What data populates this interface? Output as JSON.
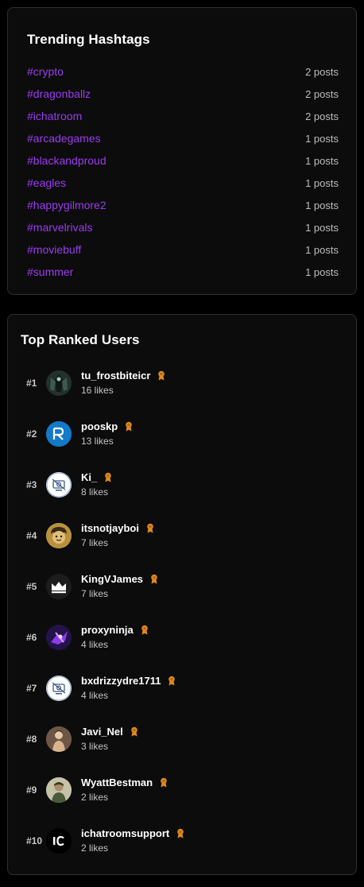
{
  "trending": {
    "title": "Trending Hashtags",
    "tags": [
      {
        "tag": "#crypto",
        "count": "2 posts"
      },
      {
        "tag": "#dragonballz",
        "count": "2 posts"
      },
      {
        "tag": "#ichatroom",
        "count": "2 posts"
      },
      {
        "tag": "#arcadegames",
        "count": "1 posts"
      },
      {
        "tag": "#blackandproud",
        "count": "1 posts"
      },
      {
        "tag": "#eagles",
        "count": "1 posts"
      },
      {
        "tag": "#happygilmore2",
        "count": "1 posts"
      },
      {
        "tag": "#marvelrivals",
        "count": "1 posts"
      },
      {
        "tag": "#moviebuff",
        "count": "1 posts"
      },
      {
        "tag": "#summer",
        "count": "1 posts"
      }
    ]
  },
  "ranked": {
    "title": "Top Ranked Users",
    "badge_icon": "award-ribbon-icon",
    "badge_color": "#e08a1e",
    "users": [
      {
        "rank": "#1",
        "name": "tu_frostbiteicr",
        "likes": "16 likes",
        "avatar": "warrior-avatar"
      },
      {
        "rank": "#2",
        "name": "pooskp",
        "likes": "13 likes",
        "avatar": "letter-r-logo-avatar"
      },
      {
        "rank": "#3",
        "name": "Ki_",
        "likes": "8 likes",
        "avatar": "no-photo-avatar"
      },
      {
        "rank": "#4",
        "name": "itsnotjayboi",
        "likes": "7 likes",
        "avatar": "cartoon-face-avatar"
      },
      {
        "rank": "#5",
        "name": "KingVJames",
        "likes": "7 likes",
        "avatar": "crown-avatar"
      },
      {
        "rank": "#6",
        "name": "proxyninja",
        "likes": "4 likes",
        "avatar": "purple-ninja-avatar"
      },
      {
        "rank": "#7",
        "name": "bxdrizzydre1711",
        "likes": "4 likes",
        "avatar": "no-photo-avatar"
      },
      {
        "rank": "#8",
        "name": "Javi_Nel",
        "likes": "3 likes",
        "avatar": "person-photo-avatar"
      },
      {
        "rank": "#9",
        "name": "WyattBestman",
        "likes": "2 likes",
        "avatar": "portrait-photo-avatar"
      },
      {
        "rank": "#10",
        "name": "ichatroomsupport",
        "likes": "2 likes",
        "avatar": "ic-logo-avatar"
      }
    ]
  }
}
